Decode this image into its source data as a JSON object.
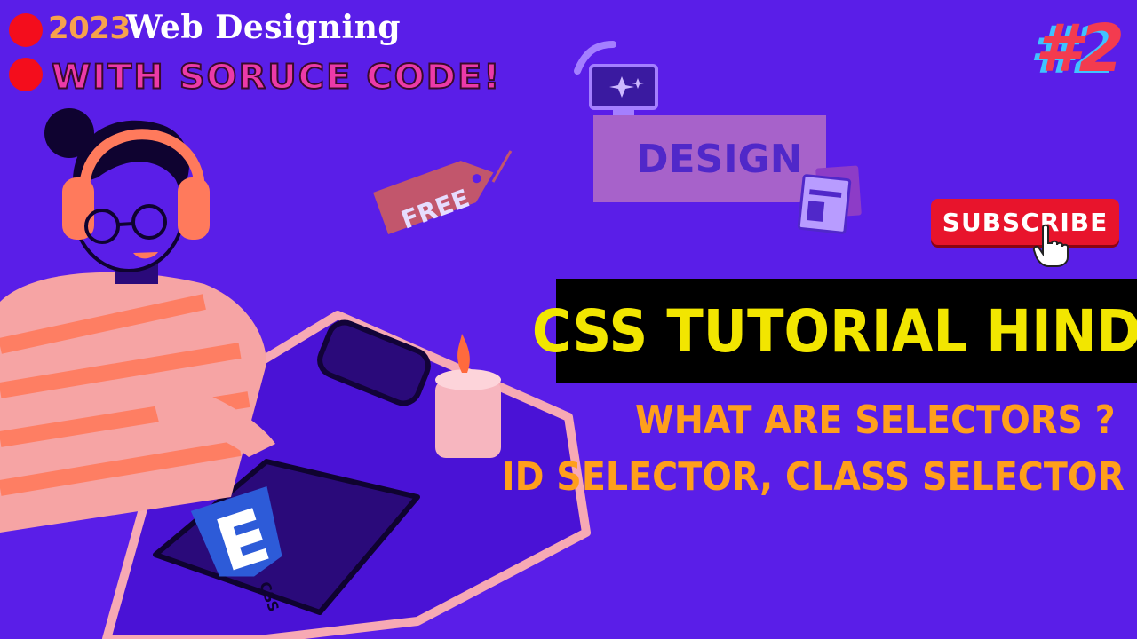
{
  "header": {
    "year": "2023",
    "title": "Web Designing",
    "subtitle": "WITH SORUCE CODE!"
  },
  "episode": "#2",
  "subscribe_label": "SUBSCRIBE",
  "illustration": {
    "tag_label": "FREE",
    "sign_label": "DESIGN",
    "book_logo": "CSS"
  },
  "banner": {
    "title": "CSS TUTORIAL HINDI"
  },
  "topics": [
    "WHAT ARE SELECTORS ?",
    "ID SELECTOR, CLASS SELECTOR"
  ],
  "colors": {
    "background": "#5a1ee8",
    "banner_bg": "#000000",
    "banner_text": "#f2e600",
    "topic_text": "#ff9f1c",
    "subscribe_bg": "#e8142c",
    "dot_red": "#f40d1c"
  }
}
